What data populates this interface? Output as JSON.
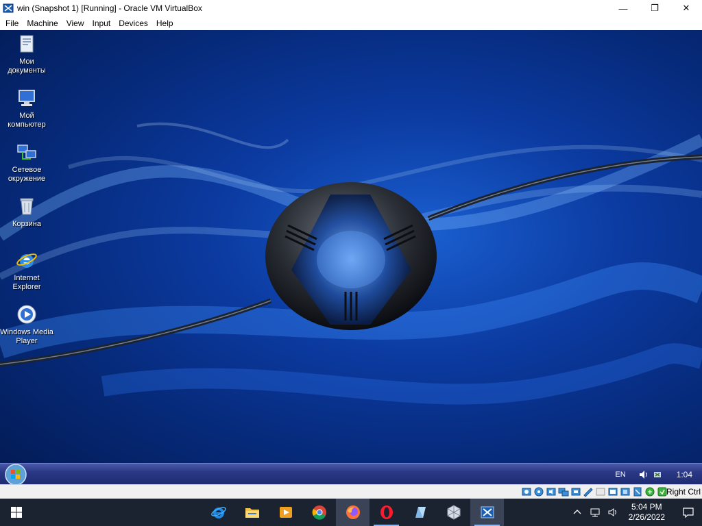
{
  "window": {
    "title": "win (Snapshot 1) [Running] - Oracle VM VirtualBox",
    "minimize": "—",
    "maximize": "❐",
    "close": "✕"
  },
  "menu": [
    "File",
    "Machine",
    "View",
    "Input",
    "Devices",
    "Help"
  ],
  "desktop": {
    "icons": [
      {
        "label": "Мои документы",
        "icon": "documents-icon"
      },
      {
        "label": "Мой компьютер",
        "icon": "computer-icon"
      },
      {
        "label": "Сетевое окружение",
        "icon": "network-icon"
      },
      {
        "label": "Корзина",
        "icon": "recycle-bin-icon"
      },
      {
        "label": "Internet Explorer",
        "icon": "ie-icon"
      },
      {
        "label": "Windows Media Player",
        "icon": "media-player-icon"
      }
    ]
  },
  "guest_taskbar": {
    "language": "EN",
    "clock": "1:04"
  },
  "vbox_statusbar": {
    "host_key": "Right Ctrl"
  },
  "host_taskbar": {
    "apps": [
      "ie-icon",
      "file-explorer-icon",
      "media-app-icon",
      "chrome-icon",
      "firefox-icon",
      "opera-icon",
      "app-icon",
      "virtualbox-icon",
      "xp-vm-icon"
    ],
    "time": "5:04 PM",
    "date": "2/26/2022"
  },
  "colors": {
    "guest_taskbar": "#2a3886",
    "host_taskbar": "#1c2330",
    "desktop_blue": "#0b3aa0"
  }
}
